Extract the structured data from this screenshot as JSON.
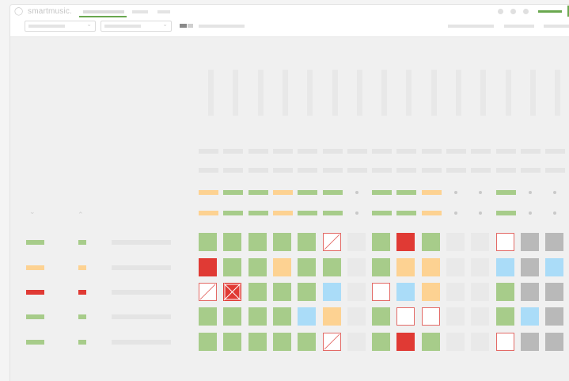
{
  "app": {
    "logo_text": "smartmusic."
  },
  "colors": {
    "accent_green": "#6aa84f",
    "good": "#a7cc8a",
    "warning": "#fdd292",
    "bad": "#e03a34",
    "info": "#aadcf8",
    "empty": "#e9e9e9",
    "grey": "#b9b9b9"
  },
  "icons": {
    "logo": "smartmusic-logo-icon",
    "sort_down": "chevron-down-icon",
    "sort_up": "chevron-up-icon",
    "window_dots": "window-control-dot-icon",
    "missing": "diagonal-slash-icon",
    "excused": "x-mark-icon"
  },
  "summary_bars": {
    "row1": [
      "o",
      "g",
      "g",
      "o",
      "g",
      "g",
      "dot",
      "g",
      "g",
      "o",
      "dot",
      "dot",
      "g",
      "dot",
      "dot"
    ],
    "row2": [
      "o",
      "g",
      "g",
      "o",
      "g",
      "g",
      "dot",
      "g",
      "g",
      "o",
      "dot",
      "dot",
      "g",
      "dot",
      "dot"
    ]
  },
  "legend_rows": [
    "g",
    "o",
    "r",
    "g",
    "g"
  ],
  "grid_rows": [
    [
      "g",
      "g",
      "g",
      "g",
      "g",
      "slash",
      "e",
      "g",
      "r",
      "g",
      "e",
      "e",
      "w",
      "gr",
      "gr"
    ],
    [
      "r",
      "g",
      "g",
      "o",
      "g",
      "g",
      "e",
      "g",
      "o",
      "o",
      "e",
      "e",
      "b",
      "gr",
      "b"
    ],
    [
      "slash",
      "x",
      "g",
      "g",
      "g",
      "b",
      "e",
      "w",
      "b",
      "o",
      "e",
      "e",
      "g",
      "gr",
      "gr"
    ],
    [
      "g",
      "g",
      "g",
      "g",
      "b",
      "o",
      "e",
      "g",
      "w",
      "w",
      "e",
      "e",
      "g",
      "b",
      "gr"
    ],
    [
      "g",
      "g",
      "g",
      "g",
      "g",
      "slash",
      "e",
      "g",
      "r",
      "g",
      "e",
      "e",
      "w",
      "gr",
      "gr"
    ]
  ]
}
